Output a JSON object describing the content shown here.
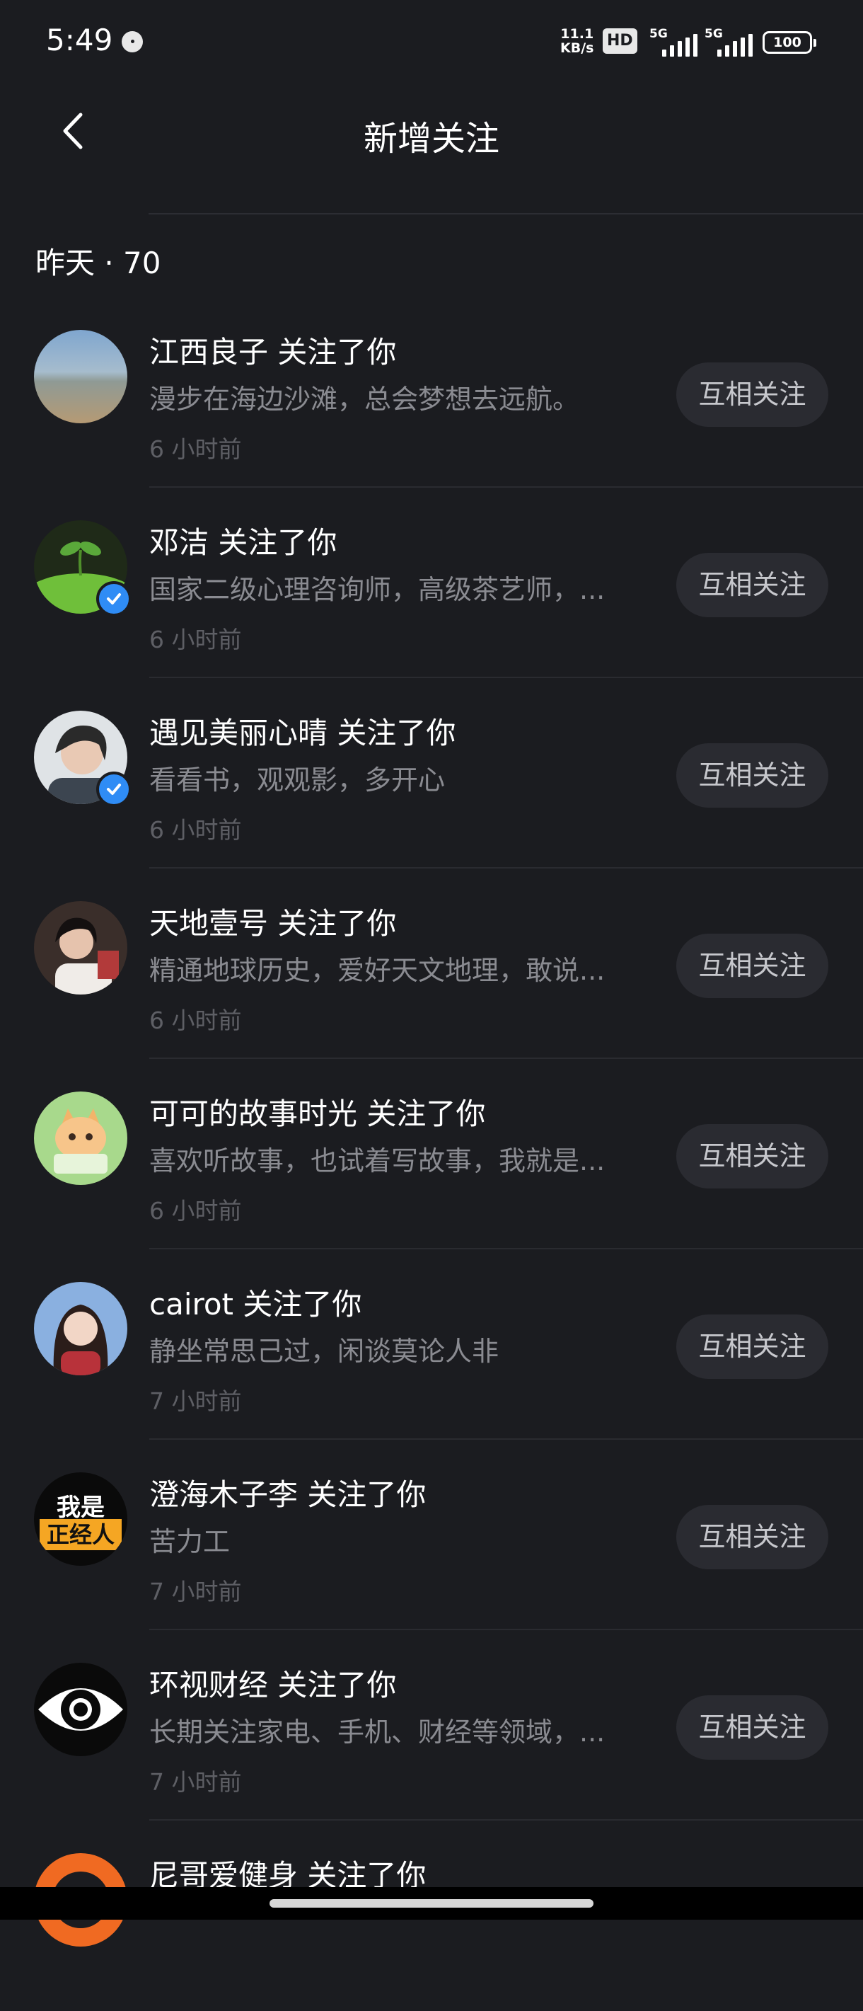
{
  "status_bar": {
    "time": "5:49",
    "net_speed_value": "11.1",
    "net_speed_unit": "KB/s",
    "hd_label": "HD",
    "sim1_label": "5G",
    "sim2_label": "5G",
    "battery": "100"
  },
  "header": {
    "title": "新增关注"
  },
  "section": {
    "label": "昨天 · 70"
  },
  "items": [
    {
      "name": "江西良子 关注了你",
      "bio": "漫步在海边沙滩，总会梦想去远航。",
      "time": "6 小时前",
      "button": "互相关注"
    },
    {
      "name": "邓洁 关注了你",
      "bio": "国家二级心理咨询师，高级茶艺师，...",
      "time": "6 小时前",
      "button": "互相关注"
    },
    {
      "name": "遇见美丽心晴 关注了你",
      "bio": "看看书，观观影，多开心",
      "time": "6 小时前",
      "button": "互相关注"
    },
    {
      "name": "天地壹号 关注了你",
      "bio": "精通地球历史，爱好天文地理，敢说...",
      "time": "6 小时前",
      "button": "互相关注"
    },
    {
      "name": "可可的故事时光 关注了你",
      "bio": "喜欢听故事，也试着写故事，我就是...",
      "time": "6 小时前",
      "button": "互相关注"
    },
    {
      "name": "cairot 关注了你",
      "bio": "静坐常思己过，闲谈莫论人非",
      "time": "7 小时前",
      "button": "互相关注"
    },
    {
      "name": "澄海木子李 关注了你",
      "bio": "苦力工",
      "time": "7 小时前",
      "button": "互相关注"
    },
    {
      "name": "环视财经 关注了你",
      "bio": "长期关注家电、手机、财经等领域，...",
      "time": "7 小时前",
      "button": "互相关注"
    },
    {
      "name": "尼哥爱健身 关注了你"
    }
  ],
  "avatar_text": {
    "line1": "我是",
    "line2": "正经人"
  }
}
